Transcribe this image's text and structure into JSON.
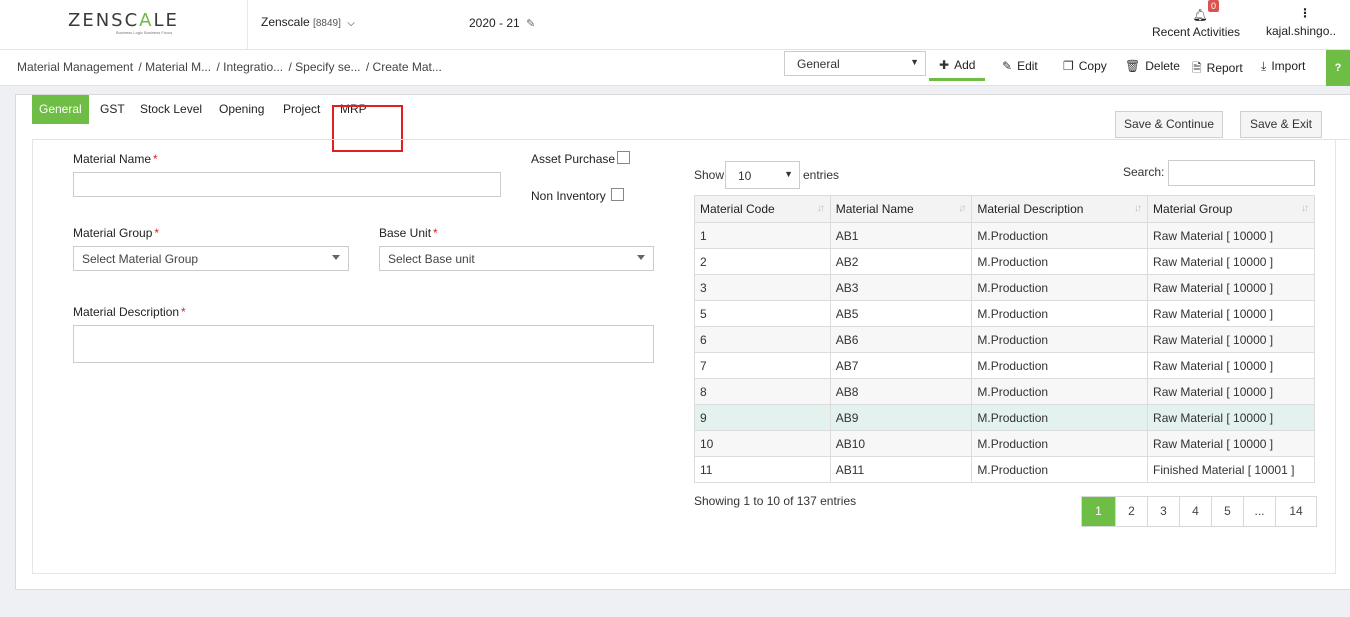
{
  "header": {
    "logo_text_left": "ZENSC",
    "logo_text_accent": "A",
    "logo_text_right": "LE",
    "logo_tagline": "Business Logic Business Focus",
    "company_name": "Zenscale",
    "company_code": "[8849]",
    "fiscal_year": "2020 - 21",
    "notification_count": "0",
    "recent_label": "Recent Activities",
    "user_name": "kajal.shingo.."
  },
  "breadcrumb": {
    "items": [
      "Material Management",
      "/ Material M...",
      "/ Integratio...",
      "/ Specify se...",
      "/ Create Mat..."
    ]
  },
  "toolbar": {
    "mode_value": "General",
    "add_label": "Add",
    "edit_label": "Edit",
    "copy_label": "Copy",
    "delete_label": "Delete",
    "report_label": "Report",
    "import_label": "Import"
  },
  "tabs": [
    "General",
    "GST",
    "Stock Level",
    "Opening",
    "Project",
    "MRP"
  ],
  "actions": {
    "save_continue": "Save & Continue",
    "save_exit": "Save & Exit"
  },
  "form": {
    "material_name_label": "Material Name",
    "asset_purchase_label": "Asset Purchase",
    "non_inventory_label": "Non Inventory",
    "material_group_label": "Material Group",
    "material_group_placeholder": "Select Material Group",
    "base_unit_label": "Base Unit",
    "base_unit_placeholder": "Select Base unit",
    "material_description_label": "Material Description",
    "required_mark": "*"
  },
  "table": {
    "show_label": "Show",
    "page_length": "10",
    "entries_label": "entries",
    "search_label": "Search:",
    "columns": [
      "Material Code",
      "Material Name",
      "Material Description",
      "Material Group"
    ],
    "rows": [
      [
        "1",
        "AB1",
        "M.Production",
        "Raw Material [ 10000 ]"
      ],
      [
        "2",
        "AB2",
        "M.Production",
        "Raw Material [ 10000 ]"
      ],
      [
        "3",
        "AB3",
        "M.Production",
        "Raw Material [ 10000 ]"
      ],
      [
        "5",
        "AB5",
        "M.Production",
        "Raw Material [ 10000 ]"
      ],
      [
        "6",
        "AB6",
        "M.Production",
        "Raw Material [ 10000 ]"
      ],
      [
        "7",
        "AB7",
        "M.Production",
        "Raw Material [ 10000 ]"
      ],
      [
        "8",
        "AB8",
        "M.Production",
        "Raw Material [ 10000 ]"
      ],
      [
        "9",
        "AB9",
        "M.Production",
        "Raw Material [ 10000 ]"
      ],
      [
        "10",
        "AB10",
        "M.Production",
        "Raw Material [ 10000 ]"
      ],
      [
        "11",
        "AB11",
        "M.Production",
        "Finished Material [ 10001 ]"
      ]
    ],
    "highlighted_row": 7,
    "info_text": "Showing 1 to 10 of 137 entries",
    "pages": [
      "1",
      "2",
      "3",
      "4",
      "5",
      "...",
      "14"
    ]
  },
  "colors": {
    "accent": "#6ebd44",
    "highlight_border": "#e02020",
    "required": "#d9232e",
    "selected_row": "#e4f2ef"
  }
}
